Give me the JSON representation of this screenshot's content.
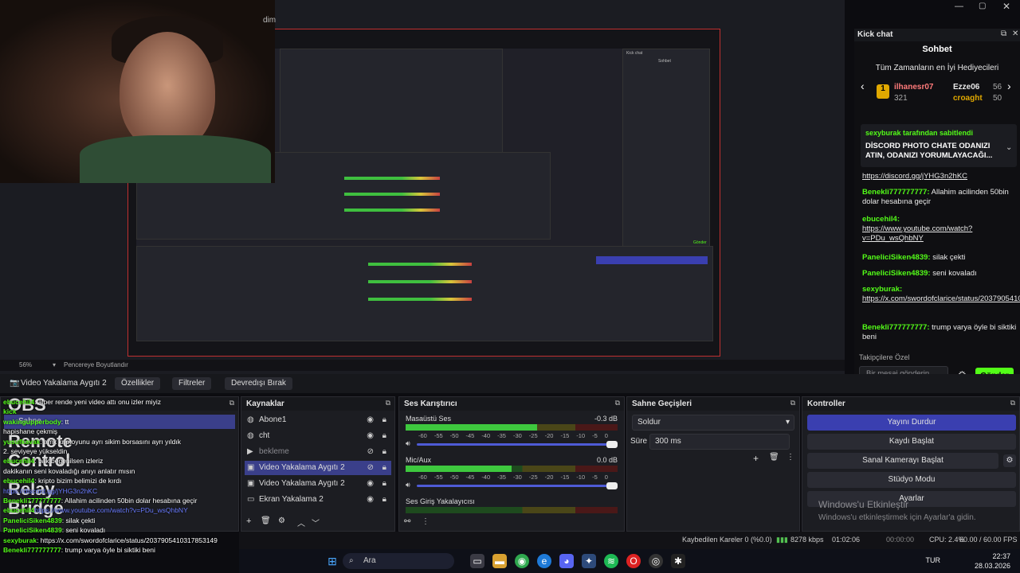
{
  "titlebar": {
    "title_fragment": "dim"
  },
  "preview": {
    "zoom": "56%",
    "fit_label": "Pencereye Boyutlandır",
    "mini_chat_title": "Kick chat",
    "mini_chat_tab": "Sohbet",
    "mini_send": "Gönder"
  },
  "chat": {
    "title": "Kick chat",
    "tab": "Sohbet",
    "top_gifters_title": "Tüm Zamanların en İyi Hediyecileri",
    "gifters": [
      {
        "rank": "1",
        "name": "ilhanesr07",
        "count": "321"
      },
      {
        "name": "Ezze06",
        "count": "56"
      },
      {
        "name": "croaght",
        "count": "50"
      }
    ],
    "pinned_by": "sexyburak tarafından sabitlendi",
    "pinned_text": "DİSCORD PHOTO CHATE ODANIZI ATIN, ODANIZI YORUMLAYACAĞI...",
    "messages": [
      {
        "user": "",
        "text": "https://discord.gg/jYHG3n2hKC"
      },
      {
        "user": "Benekli777777777:",
        "text": "Allahim acilinden 50bin dolar hesabına geçir"
      },
      {
        "user": "ebucehil4:",
        "text": "https://www.youtube.com/watch?v=PDu_wsQhbNY"
      },
      {
        "user": "PaneliciSiken4839:",
        "text": "silak çekti"
      },
      {
        "user": "PaneliciSiken4839:",
        "text": "seni kovaladı"
      },
      {
        "user": "sexyburak:",
        "text": "https://x.com/swordofclarice/status/2037905410317853149"
      },
      {
        "user": "Benekli777777777:",
        "text": "trump varya öyle bi siktiki beni"
      }
    ],
    "followers_only": "Takipçilere Özel",
    "input_placeholder": "Bir mesaj gönderin",
    "send_label": "Gönder"
  },
  "source_toolbar": {
    "source_name": "Video Yakalama Aygıtı 2",
    "properties": "Özellikler",
    "filters": "Filtreler",
    "deactivate": "Devredışı Bırak"
  },
  "scenes": {
    "title": "Sahne",
    "items": [
      "Sahne"
    ]
  },
  "sources": {
    "title": "Kaynaklar",
    "items": [
      "Abone1",
      "cht",
      "bekleme",
      "Video Yakalama Aygıtı 2",
      "Video Yakalama Aygıtı 2",
      "Ekran Yakalama 2"
    ]
  },
  "mixer": {
    "title": "Ses Karıştırıcı",
    "channels": [
      {
        "name": "Masaüstü Ses",
        "db": "-0.3 dB",
        "level": 0.62
      },
      {
        "name": "Mic/Aux",
        "db": "0.0 dB",
        "level": 0.5
      },
      {
        "name": "Ses Giriş Yakalayıcısı",
        "db": "",
        "level": 0.0
      }
    ],
    "ticks": [
      "-60",
      "-55",
      "-50",
      "-45",
      "-40",
      "-35",
      "-30",
      "-25",
      "-20",
      "-15",
      "-10",
      "-5",
      "0"
    ]
  },
  "transitions": {
    "title": "Sahne Geçişleri",
    "selected": "Soldur",
    "duration_label": "Süre",
    "duration_value": "300 ms"
  },
  "controls": {
    "title": "Kontroller",
    "buttons": [
      "Yayını Durdur",
      "Kaydı Başlat",
      "Sanal Kamerayı Başlat",
      "Stüdyo Modu",
      "Ayarlar"
    ]
  },
  "watermark": {
    "title": "Windows'u Etkinleştir",
    "subtitle": "Windows'u etkinleştirmek için Ayarlar'a gidin."
  },
  "overlay_chat": [
    {
      "user": "ebucehil4",
      "text": ": alper rende yeni video attı onu izler miyiz"
    },
    {
      "user": "kick",
      "text": ""
    },
    {
      "user": "wakingupperbody",
      "text": ": tt"
    },
    {
      "user": "",
      "text": "hapishane çekmiş"
    },
    {
      "user": "yusufkavak",
      "text": ": amk kriptoyunu ayrı sikim borsasını ayrı yıldık"
    },
    {
      "user": "",
      "text": "2. seviyeye yükseldin."
    },
    {
      "user": "ebucehil4",
      "text": ": bak beğenilsen izleriz"
    },
    {
      "user": "",
      "text": "dakikanın seni kovaladığı anıyı anlatır mısın"
    },
    {
      "user": "ebucehil4",
      "text": ": kripto bizim belimizi de kırdı"
    },
    {
      "user": "",
      "text": "https://discord.gg/jYHG3n2hKC"
    },
    {
      "user": "Benekli777777777",
      "text": ": Allahim acilinden 50bin dolar hesabına geçir"
    },
    {
      "user": "ebucehil4",
      "text": "https://www.youtube.com/watch?v=PDu_wsQhbNY"
    },
    {
      "user": "PaneliciSiken4839",
      "text": ": silak çekti"
    },
    {
      "user": "PaneliciSiken4839",
      "text": ": seni kovaladı"
    },
    {
      "user": "sexyburak",
      "text": ": https://x.com/swordofclarice/status/2037905410317853149"
    },
    {
      "user": "Benekli777777777",
      "text": ": trump varya öyle bi siktiki beni"
    }
  ],
  "overlay_big": [
    "OBS",
    "Remote",
    "Control",
    "Relay",
    "Bridge"
  ],
  "statusbar": {
    "dropped": "Kaybedilen Kareler 0 (%0.0)",
    "kbps": "8278 kbps",
    "live_time": "01:02:06",
    "rec_time": "00:00:00",
    "cpu": "CPU: 2.4%",
    "fps": "60.00 / 60.00 FPS"
  },
  "taskbar": {
    "search": "Ara",
    "lang": "TUR",
    "time": "22:37",
    "date": "28.03.2026"
  },
  "colors": {
    "accent": "#53fc18",
    "selection": "#3a3f8a",
    "live": "#3a3fb0"
  }
}
